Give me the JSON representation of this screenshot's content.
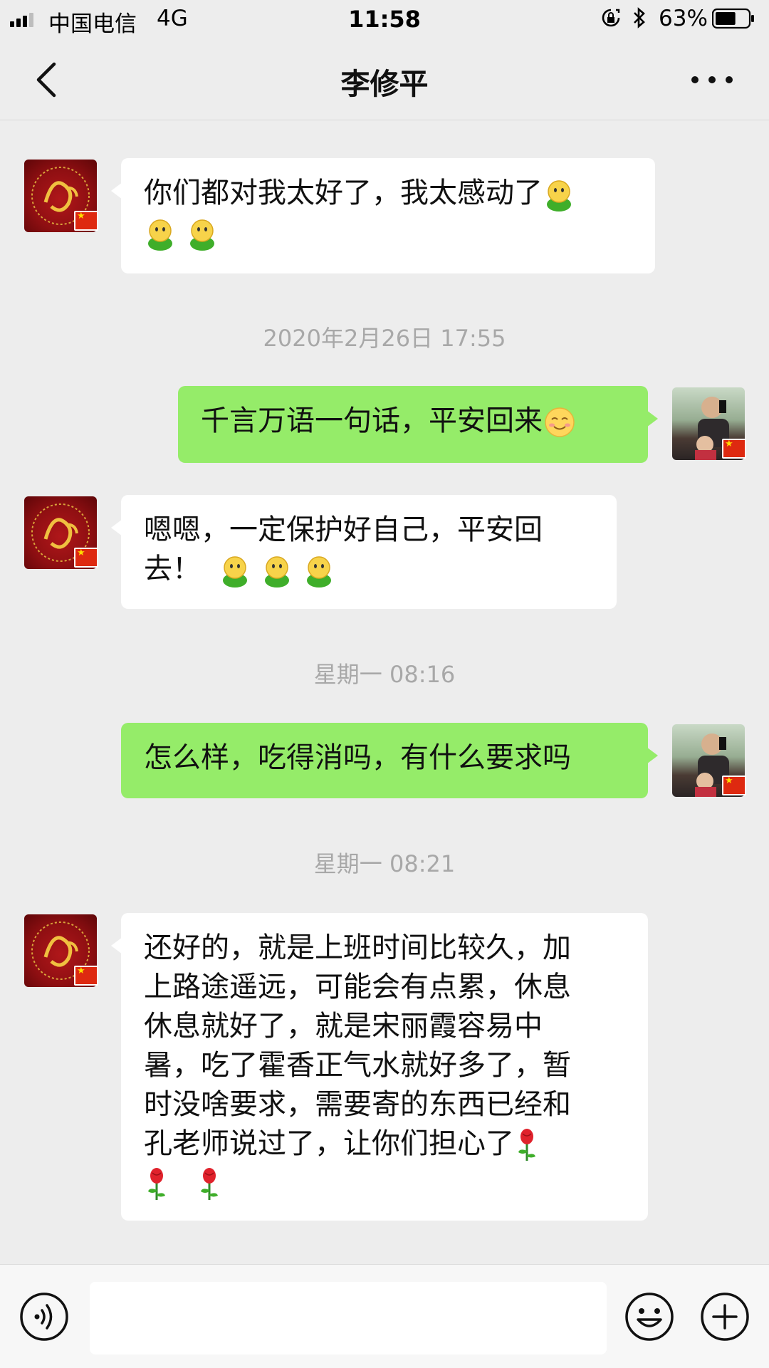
{
  "status_bar": {
    "carrier": "中国电信",
    "network": "4G",
    "time": "11:58",
    "battery_percent": "63%",
    "battery_level": 0.63
  },
  "header": {
    "title": "李修平",
    "back_icon": "chevron-left-icon",
    "more_icon": "more-dots-icon"
  },
  "messages": [
    {
      "from": "contact",
      "lines": [
        "你们都对我太好了，我太感动了",
        ""
      ],
      "emoji": "smiley-emoji",
      "emoji_count": 3
    },
    {
      "timestamp": "2020年2月26日 17:55"
    },
    {
      "from": "me",
      "lines": [
        "千言万语一句话，平安回来"
      ],
      "emoji": "blush-emoji",
      "emoji_count": 1
    },
    {
      "from": "contact",
      "lines": [
        "嗯嗯，一定保护好自己，平安回",
        "去！"
      ],
      "emoji": "smiley-emoji",
      "emoji_count": 3
    },
    {
      "timestamp": "星期一 08:16"
    },
    {
      "from": "me",
      "lines": [
        "怎么样，吃得消吗，有什么要求吗"
      ]
    },
    {
      "timestamp": "星期一 08:21"
    },
    {
      "from": "contact",
      "lines": [
        "还好的，就是上班时间比较久，加",
        "上路途遥远，可能会有点累，休息",
        "休息就好了，就是宋丽霞容易中",
        "暑，吃了霍香正气水就好多了，暂",
        "时没啥要求，需要寄的东西已经和",
        "孔老师说过了，让你们担心了"
      ],
      "emoji": "rose-emoji",
      "emoji_count": 3
    }
  ],
  "input_bar": {
    "voice_icon": "voice-icon",
    "emoji_icon": "emoji-icon",
    "add_icon": "plus-circle-icon"
  },
  "colors": {
    "background": "#ededed",
    "outgoing_bubble": "#95ec69",
    "incoming_bubble": "#ffffff",
    "timestamp_text": "#a8a8a8"
  }
}
